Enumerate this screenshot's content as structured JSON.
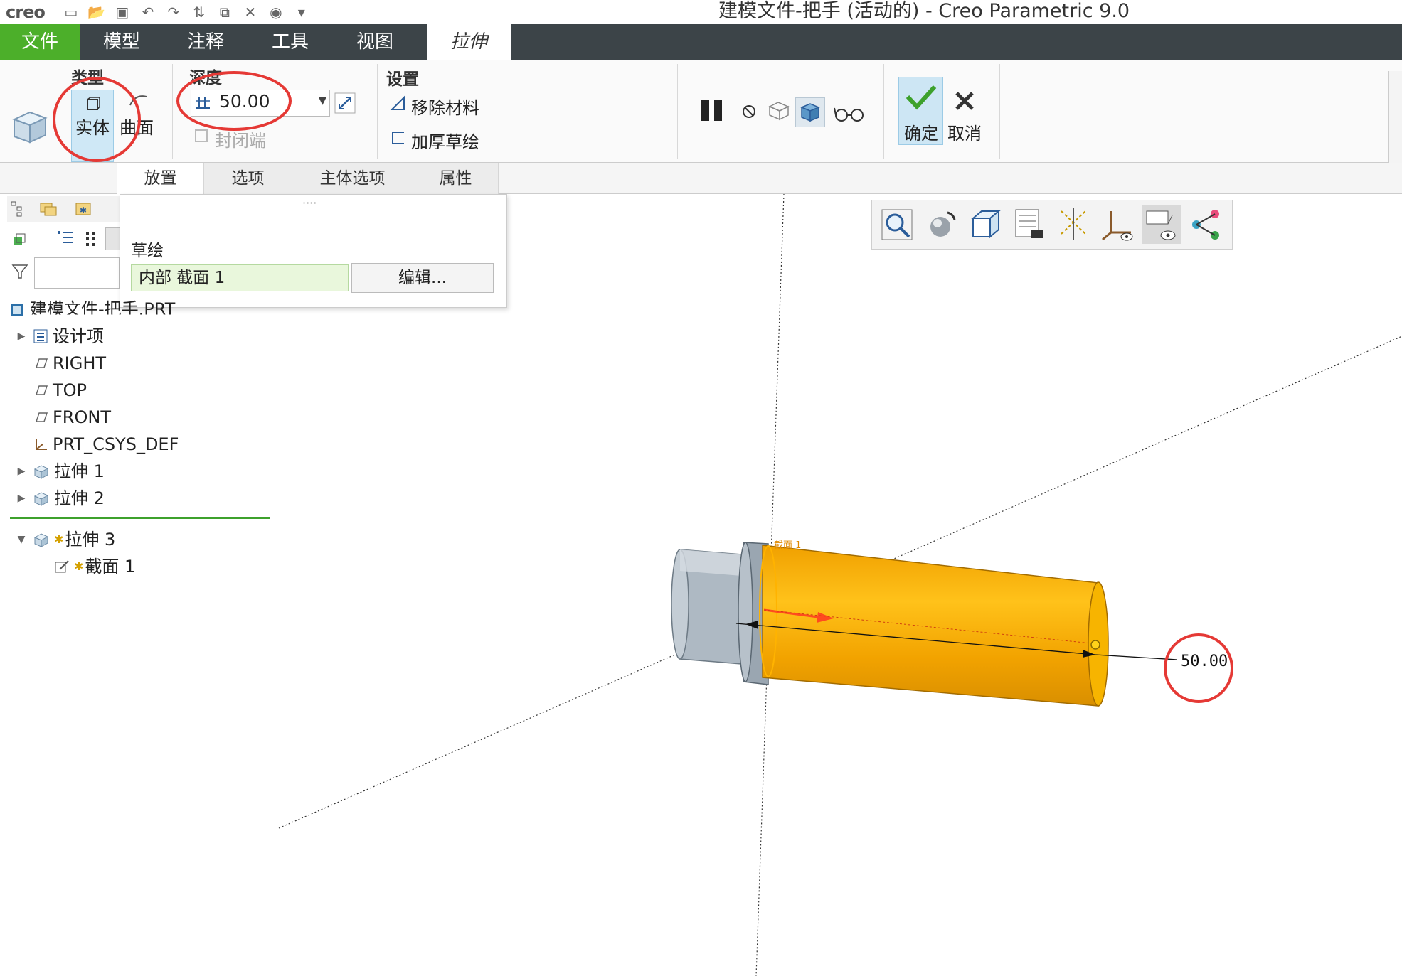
{
  "titlebar": {
    "logo": "creo",
    "title": "建模文件-把手 (活动的) - Creo Parametric 9.0"
  },
  "menu": {
    "file": "文件",
    "model": "模型",
    "annotate": "注释",
    "tools": "工具",
    "view": "视图",
    "extrude": "拉伸"
  },
  "ribbon": {
    "type_group": "类型",
    "solid": "实体",
    "surface": "曲面",
    "depth_group": "深度",
    "depth_value": "50.00",
    "close_ends": "封闭端",
    "settings_group": "设置",
    "remove_material": "移除材料",
    "thicken_sketch": "加厚草绘",
    "ok": "确定",
    "cancel": "取消"
  },
  "subtabs": {
    "placement": "放置",
    "options": "选项",
    "body_options": "主体选项",
    "properties": "属性"
  },
  "placement_panel": {
    "sketch_label": "草绘",
    "sketch_value": "内部 截面 1",
    "edit_button": "编辑..."
  },
  "model_tree": {
    "root": "建模文件-把手.PRT",
    "items": [
      {
        "label": "设计项",
        "icon": "design-items-icon",
        "expandable": true
      },
      {
        "label": "RIGHT",
        "icon": "datum-plane-icon",
        "expandable": false
      },
      {
        "label": "TOP",
        "icon": "datum-plane-icon",
        "expandable": false
      },
      {
        "label": "FRONT",
        "icon": "datum-plane-icon",
        "expandable": false
      },
      {
        "label": "PRT_CSYS_DEF",
        "icon": "csys-icon",
        "expandable": false
      },
      {
        "label": "拉伸 1",
        "icon": "extrude-icon",
        "expandable": true
      },
      {
        "label": "拉伸 2",
        "icon": "extrude-icon",
        "expandable": true
      }
    ],
    "active_feature": "拉伸 3",
    "active_child": "截面 1"
  },
  "viewport": {
    "dimension_label": "50.00",
    "section_tag": "截面 1",
    "colors": {
      "body_gray": "#b9c3cc",
      "extrude_orange": "#f5a300",
      "dimension_ring": "#e53935"
    }
  }
}
